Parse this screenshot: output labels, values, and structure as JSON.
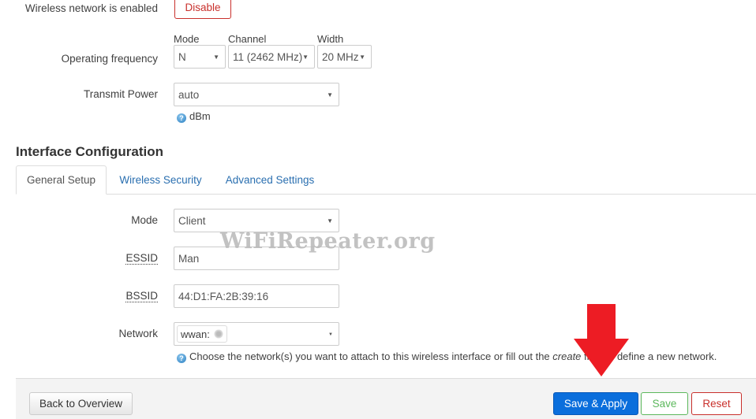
{
  "wireless_status": {
    "label": "Wireless network is enabled",
    "disable_button": "Disable"
  },
  "operating_frequency": {
    "label": "Operating frequency",
    "mode": {
      "label": "Mode",
      "value": "N"
    },
    "channel": {
      "label": "Channel",
      "value": "11 (2462 MHz)"
    },
    "width": {
      "label": "Width",
      "value": "20 MHz"
    }
  },
  "transmit_power": {
    "label": "Transmit Power",
    "value": "auto",
    "help_text": "dBm"
  },
  "interface_config": {
    "title": "Interface Configuration",
    "tabs": [
      {
        "label": "General Setup",
        "active": true
      },
      {
        "label": "Wireless Security",
        "active": false
      },
      {
        "label": "Advanced Settings",
        "active": false
      }
    ],
    "mode": {
      "label": "Mode",
      "value": "Client"
    },
    "essid": {
      "label": "ESSID",
      "value": "Man"
    },
    "bssid": {
      "label": "BSSID",
      "value": "44:D1:FA:2B:39:16"
    },
    "network": {
      "label": "Network",
      "value": "wwan:",
      "help_prefix": "Choose the network(s) you want to attach to this wireless interface or fill out the ",
      "help_italic": "create",
      "help_suffix": " field to define a new network."
    }
  },
  "watermark": "WiFiRepeater.org",
  "footer": {
    "back_button": "Back to Overview",
    "save_apply_button": "Save & Apply",
    "save_button": "Save",
    "reset_button": "Reset"
  },
  "colors": {
    "link": "#2a6fb0",
    "primary": "#0a6edc",
    "danger": "#c9302c",
    "success": "#5cb85c",
    "annotation_arrow": "#ed1c24"
  }
}
